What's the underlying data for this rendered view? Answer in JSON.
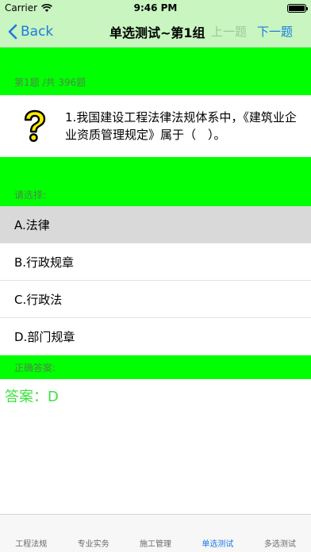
{
  "status_bar": {
    "carrier": "Carrier",
    "time": "9:46 PM"
  },
  "nav": {
    "back_label": "Back",
    "title": "单选测试~第1组",
    "prev_label": "上一题",
    "next_label": "下一题"
  },
  "progress": "第1题 /共 396题",
  "question": {
    "text": "1.我国建设工程法律法规体系中，《建筑业企业资质管理规定》属于（　）。"
  },
  "prompt": "请选择:",
  "options": [
    {
      "label": "A.法律",
      "selected": true
    },
    {
      "label": "B.行政规章",
      "selected": false
    },
    {
      "label": "C.行政法",
      "selected": false
    },
    {
      "label": "D.部门规章",
      "selected": false
    }
  ],
  "answer_header": "正确答案:",
  "answer": "答案：D",
  "tabs": [
    {
      "label": "工程法规",
      "active": false
    },
    {
      "label": "专业实务",
      "active": false
    },
    {
      "label": "施工管理",
      "active": false
    },
    {
      "label": "单选测试",
      "active": true
    },
    {
      "label": "多选测试",
      "active": false
    }
  ],
  "colors": {
    "accent": "#1f7ae0",
    "green": "#00ff00",
    "header_bg": "#c8f5c0",
    "answer": "#3ee23e"
  }
}
